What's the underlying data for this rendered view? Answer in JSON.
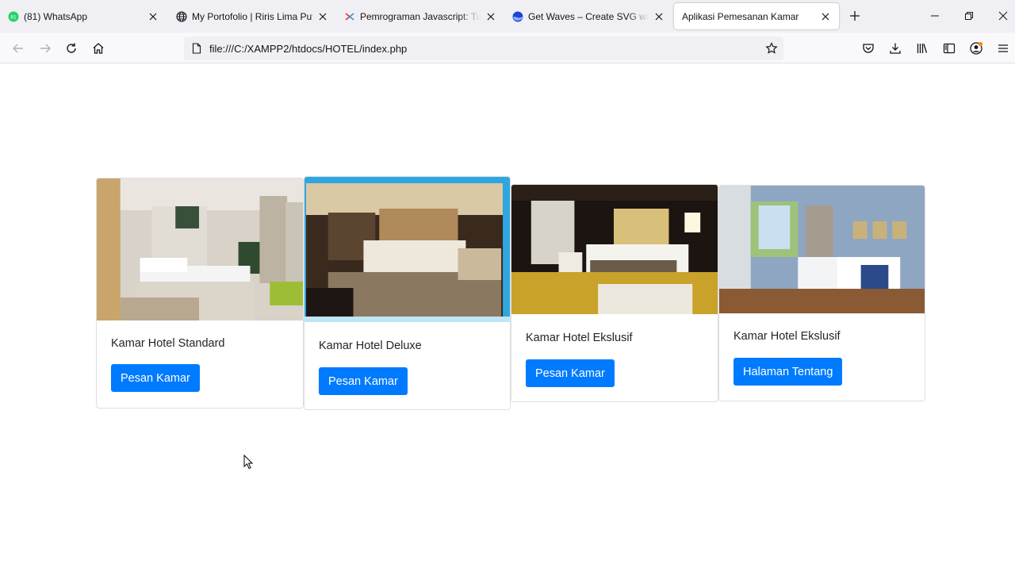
{
  "browser": {
    "tabs": [
      {
        "title": "(81) WhatsApp",
        "badge": "81",
        "active": false
      },
      {
        "title": "My Portofolio | Riris Lima Putri",
        "active": false
      },
      {
        "title": "Pemrograman Javascript: Tugas",
        "active": false
      },
      {
        "title": "Get Waves – Create SVG waves f",
        "active": false
      },
      {
        "title": "Aplikasi Pemesanan Kamar",
        "active": true
      }
    ],
    "url": "file:///C:/XAMPP2/htdocs/HOTEL/index.php"
  },
  "rooms": [
    {
      "title": "Kamar Hotel Standard",
      "button": "Pesan Kamar"
    },
    {
      "title": "Kamar Hotel Deluxe",
      "button": "Pesan Kamar"
    },
    {
      "title": "Kamar Hotel Ekslusif",
      "button": "Pesan Kamar"
    },
    {
      "title": "Kamar Hotel Ekslusif",
      "button": "Halaman Tentang"
    }
  ],
  "colors": {
    "primary": "#007bff",
    "tabbar": "#f0f0f4",
    "whatsapp": "#25d366"
  }
}
